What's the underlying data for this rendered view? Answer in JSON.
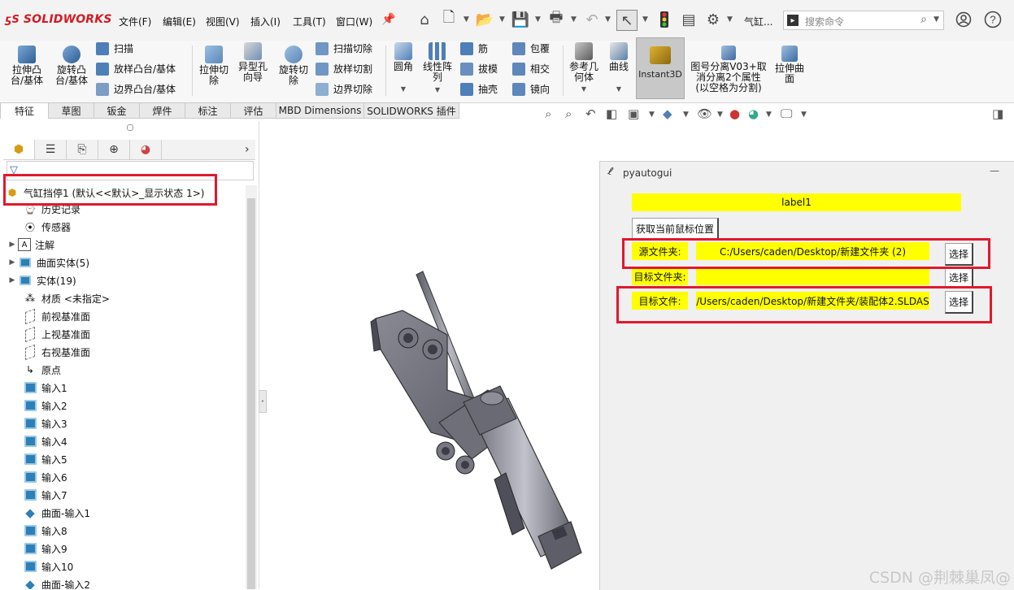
{
  "app": {
    "logo_text": "SOLIDWORKS",
    "menu": [
      "文件(F)",
      "编辑(E)",
      "视图(V)",
      "插入(I)",
      "工具(T)",
      "窗口(W)"
    ],
    "doc_title": "气缸...",
    "search_placeholder": "搜索命令",
    "help_icon_text": "?",
    "accent_color": "#d21b24"
  },
  "ribbon": {
    "extrude_boss": "拉伸凸台/基体",
    "revolve_boss": "旋转凸台/基体",
    "sweep": "扫描",
    "loft_boss": "放样凸台/基体",
    "boundary_boss": "边界凸台/基体",
    "extrude_cut": "拉伸切除",
    "hole_wizard": "异型孔向导",
    "revolve_cut": "旋转切除",
    "sweep_cut": "扫描切除",
    "loft_cut": "放样切割",
    "boundary_cut": "边界切除",
    "fillet": "圆角",
    "linear_pattern": "线性阵列",
    "rib": "筋",
    "draft": "拔模",
    "shell": "抽壳",
    "wrap": "包覆",
    "intersect": "相交",
    "mirror": "镜向",
    "ref_geometry": "参考几何体",
    "curves": "曲线",
    "instant3d": "Instant3D",
    "macro": "图号分离V03+取消分离2个属性(以空格为分割)",
    "pull_surface": "拉伸曲面"
  },
  "tabs": [
    {
      "label": "特征"
    },
    {
      "label": "草图"
    },
    {
      "label": "钣金"
    },
    {
      "label": "焊件"
    },
    {
      "label": "标注"
    },
    {
      "label": "评估"
    },
    {
      "label": "MBD Dimensions"
    },
    {
      "label": "SOLIDWORKS 插件"
    }
  ],
  "tree": {
    "root": "气缸挡停1  (默认<<默认>_显示状态 1>)",
    "items": [
      {
        "label": "历史记录"
      },
      {
        "label": "传感器"
      },
      {
        "label": "注解"
      },
      {
        "label": "曲面实体(5)"
      },
      {
        "label": "实体(19)"
      },
      {
        "label": "材质 <未指定>"
      },
      {
        "label": "前视基准面"
      },
      {
        "label": "上视基准面"
      },
      {
        "label": "右视基准面"
      },
      {
        "label": "原点"
      },
      {
        "label": "输入1"
      },
      {
        "label": "输入2"
      },
      {
        "label": "输入3"
      },
      {
        "label": "输入4"
      },
      {
        "label": "输入5"
      },
      {
        "label": "输入6"
      },
      {
        "label": "输入7"
      },
      {
        "label": "曲面-输入1"
      },
      {
        "label": "输入8"
      },
      {
        "label": "输入9"
      },
      {
        "label": "输入10"
      },
      {
        "label": "曲面-输入2"
      }
    ]
  },
  "pyautogui": {
    "title": "pyautogui",
    "minimize": "—",
    "label1": "label1",
    "get_mouse_button": "获取当前鼠标位置",
    "source_folder_label": "源文件夹:",
    "source_folder_value": "C:/Users/caden/Desktop/新建文件夹 (2)",
    "target_folder_label": "目标文件夹:",
    "target_folder_value": "",
    "target_file_label": "目标文件:",
    "target_file_value": "/Users/caden/Desktop/新建文件夹/装配体2.SLDAS",
    "choose": "选择",
    "highlight_color": "#ffff00"
  },
  "watermark": "CSDN @荆棘巢凤@"
}
